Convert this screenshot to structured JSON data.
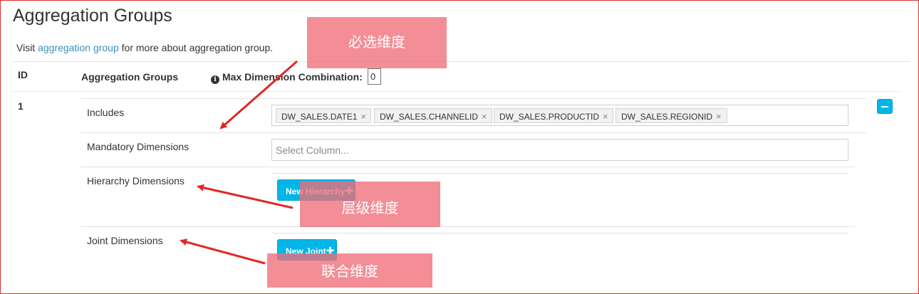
{
  "page": {
    "title": "Aggregation Groups",
    "info_prefix": "Visit ",
    "info_link": "aggregation group",
    "info_suffix": " for more about aggregation group."
  },
  "table_header": {
    "id": "ID",
    "groups": "Aggregation Groups",
    "max_dim_label": "Max Dimension Combination:",
    "max_dim_value": "0",
    "info_icon": "info-icon"
  },
  "group": {
    "id": "1",
    "includes_label": "Includes",
    "includes": [
      "DW_SALES.DATE1",
      "DW_SALES.CHANNELID",
      "DW_SALES.PRODUCTID",
      "DW_SALES.REGIONID"
    ],
    "mandatory_label": "Mandatory Dimensions",
    "mandatory_placeholder": "Select Column...",
    "hierarchy_label": "Hierarchy Dimensions",
    "new_hierarchy": "New Hierarchy",
    "joint_label": "Joint Dimensions",
    "new_joint": "New Joint",
    "plus": "✚",
    "remove_icon": "minus-icon",
    "chip_remove": "×"
  },
  "annotations": {
    "mandatory": "必选维度",
    "hierarchy": "层级维度",
    "joint": "联合维度"
  },
  "colors": {
    "accent": "#00b6e8",
    "link": "#3c8dbc",
    "annotation_bg": "#f06e78",
    "arrow": "#e02828",
    "frame": "#e0302f"
  }
}
